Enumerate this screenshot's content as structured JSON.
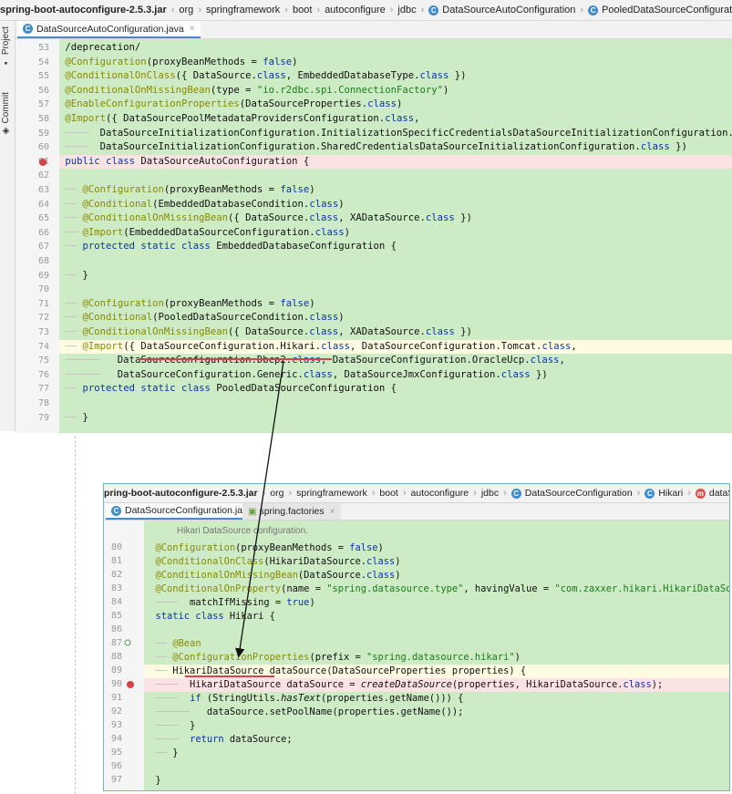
{
  "top": {
    "breadcrumb": [
      {
        "label": "spring-boot-autoconfigure-2.5.3.jar",
        "bold": true,
        "icon": null
      },
      {
        "label": "org",
        "icon": null
      },
      {
        "label": "springframework",
        "icon": null
      },
      {
        "label": "boot",
        "icon": null
      },
      {
        "label": "autoconfigure",
        "icon": null
      },
      {
        "label": "jdbc",
        "icon": null
      },
      {
        "label": "DataSourceAutoConfiguration",
        "icon": "class-icon"
      },
      {
        "label": "PooledDataSourceConfiguration",
        "icon": "class-icon"
      }
    ],
    "side_tools": {
      "project": "Project",
      "commit": "Commit"
    },
    "tab": {
      "label": "DataSourceAutoConfiguration.java",
      "close": "×"
    },
    "lines": [
      {
        "n": "53",
        "text": "/deprecation/"
      },
      {
        "n": "54",
        "text": "@Configuration(proxyBeanMethods = false)"
      },
      {
        "n": "55",
        "text": "@ConditionalOnClass({ DataSource.class, EmbeddedDatabaseType.class })"
      },
      {
        "n": "56",
        "text": "@ConditionalOnMissingBean(type = \"io.r2dbc.spi.ConnectionFactory\")"
      },
      {
        "n": "57",
        "text": "@EnableConfigurationProperties(DataSourceProperties.class)"
      },
      {
        "n": "58",
        "text": "@Import({ DataSourcePoolMetadataProvidersConfiguration.class,"
      },
      {
        "n": "59",
        "text": "DataSourceInitializationConfiguration.InitializationSpecificCredentialsDataSourceInitializationConfiguration.class,"
      },
      {
        "n": "60",
        "text": "DataSourceInitializationConfiguration.SharedCredentialsDataSourceInitializationConfiguration.class })"
      },
      {
        "n": "61",
        "text": "public class DataSourceAutoConfiguration {"
      },
      {
        "n": "62",
        "text": ""
      },
      {
        "n": "63",
        "text": "@Configuration(proxyBeanMethods = false)"
      },
      {
        "n": "64",
        "text": "@Conditional(EmbeddedDatabaseCondition.class)"
      },
      {
        "n": "65",
        "text": "@ConditionalOnMissingBean({ DataSource.class, XADataSource.class })"
      },
      {
        "n": "66",
        "text": "@Import(EmbeddedDataSourceConfiguration.class)"
      },
      {
        "n": "67",
        "text": "protected static class EmbeddedDatabaseConfiguration {"
      },
      {
        "n": "68",
        "text": ""
      },
      {
        "n": "69",
        "text": "}"
      },
      {
        "n": "70",
        "text": ""
      },
      {
        "n": "71",
        "text": "@Configuration(proxyBeanMethods = false)"
      },
      {
        "n": "72",
        "text": "@Conditional(PooledDataSourceCondition.class)"
      },
      {
        "n": "73",
        "text": "@ConditionalOnMissingBean({ DataSource.class, XADataSource.class })"
      },
      {
        "n": "74",
        "text": "@Import({ DataSourceConfiguration.Hikari.class, DataSourceConfiguration.Tomcat.class,"
      },
      {
        "n": "75",
        "text": "DataSourceConfiguration.Dbcp2.class, DataSourceConfiguration.OracleUcp.class,"
      },
      {
        "n": "76",
        "text": "DataSourceConfiguration.Generic.class, DataSourceJmxConfiguration.class })"
      },
      {
        "n": "77",
        "text": "protected static class PooledDataSourceConfiguration {"
      },
      {
        "n": "78",
        "text": ""
      },
      {
        "n": "79",
        "text": "}"
      }
    ]
  },
  "bottom": {
    "breadcrumb": [
      {
        "label": "pring-boot-autoconfigure-2.5.3.jar",
        "bold": true,
        "icon": null
      },
      {
        "label": "org",
        "icon": null
      },
      {
        "label": "springframework",
        "icon": null
      },
      {
        "label": "boot",
        "icon": null
      },
      {
        "label": "autoconfigure",
        "icon": null
      },
      {
        "label": "jdbc",
        "icon": null
      },
      {
        "label": "DataSourceConfiguration",
        "icon": "class-icon"
      },
      {
        "label": "Hikari",
        "icon": "class-icon"
      },
      {
        "label": "dataSource",
        "icon": "method-icon"
      }
    ],
    "tabs": [
      {
        "label": "DataSourceConfiguration.java",
        "close": "×"
      },
      {
        "label": "spring.factories",
        "close": "×"
      }
    ],
    "doc_comment": "Hikari DataSource configuration.",
    "lines": [
      {
        "n": "80",
        "text": "@Configuration(proxyBeanMethods = false)"
      },
      {
        "n": "81",
        "text": "@ConditionalOnClass(HikariDataSource.class)"
      },
      {
        "n": "82",
        "text": "@ConditionalOnMissingBean(DataSource.class)"
      },
      {
        "n": "83",
        "text": "@ConditionalOnProperty(name = \"spring.datasource.type\", havingValue = \"com.zaxxer.hikari.HikariDataSource\","
      },
      {
        "n": "84",
        "text": "matchIfMissing = true)"
      },
      {
        "n": "85",
        "text": "static class Hikari {"
      },
      {
        "n": "86",
        "text": ""
      },
      {
        "n": "87",
        "text": "@Bean"
      },
      {
        "n": "88",
        "text": "@ConfigurationProperties(prefix = \"spring.datasource.hikari\")"
      },
      {
        "n": "89",
        "text": "HikariDataSource dataSource(DataSourceProperties properties) {"
      },
      {
        "n": "90",
        "text": "HikariDataSource dataSource = createDataSource(properties, HikariDataSource.class);"
      },
      {
        "n": "91",
        "text": "if (StringUtils.hasText(properties.getName())) {"
      },
      {
        "n": "92",
        "text": "dataSource.setPoolName(properties.getName());"
      },
      {
        "n": "93",
        "text": "}"
      },
      {
        "n": "94",
        "text": "return dataSource;"
      },
      {
        "n": "95",
        "text": "}"
      },
      {
        "n": "96",
        "text": ""
      },
      {
        "n": "97",
        "text": "}"
      }
    ]
  },
  "colors": {
    "code_bg": "#cdebc5",
    "breakpoint": "#d6424b",
    "annotation_arrow": "#111111",
    "underline": "#d6424b"
  }
}
